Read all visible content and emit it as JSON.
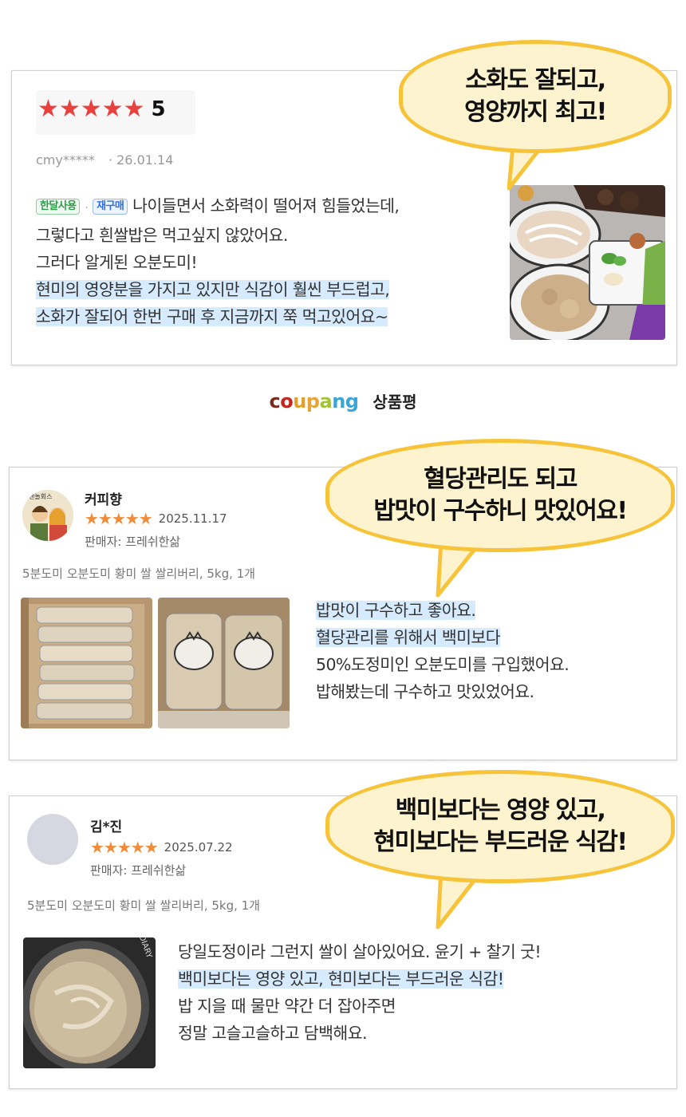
{
  "review1": {
    "rating_stars": "★★★★★",
    "rating_value": "5",
    "user": "cmy*****",
    "date": "· 26.01.14",
    "badge1": "한달사용",
    "badge_sep": "·",
    "badge2": "재구매",
    "line1": "나이들면서 소화력이 떨어져 힘들었는데,",
    "line2": "그렇다고 흰쌀밥은 먹고싶지 않았어요.",
    "line3": "그러다 알게된 오분도미!",
    "line4": "현미의 영양분을 가지고 있지만 식감이 훨씬 부드럽고,",
    "line5": "소화가 잘되어 한번 구매 후 지금까지 쭉 먹고있어요~",
    "bubble": [
      "소화도 잘되고,",
      "영양까지 최고!"
    ]
  },
  "brand": {
    "logo_c": "c",
    "logo_o": "o",
    "logo_u": "u",
    "logo_p": "p",
    "logo_a": "a",
    "logo_n": "n",
    "logo_g": "g",
    "label": "상품평"
  },
  "review2": {
    "user": "커피향",
    "avatar_text": "낸놀회스",
    "stars": "★★★★★",
    "date": "2025.11.17",
    "seller": "판매자: 프레쉬한삶",
    "product": "5분도미 오분도미 황미 쌀 쌀리버리, 5kg, 1개",
    "line1": "밥맛이 구수하고 좋아요.",
    "line2": "혈당관리를 위해서 백미보다",
    "line3": "50%도정미인 오분도미를 구입했어요.",
    "line4": "밥해봤는데 구수하고 맛있었어요.",
    "bubble": [
      "혈당관리도 되고",
      "밥맛이 구수하니 맛있어요!"
    ]
  },
  "review3": {
    "user": "김*진",
    "stars": "★★★★★",
    "date": "2025.07.22",
    "seller": "판매자: 프레쉬한삶",
    "product": "5분도미 오분도미 황미 쌀 쌀리버리, 5kg, 1개",
    "line1": "당일도정이라 그런지 쌀이 살아있어요. 윤기 + 찰기 굿!",
    "line2": "백미보다는 영양 있고, 현미보다는 부드러운 식감!",
    "line3": "밥 지을 때 물만 약간 더 잡아주면",
    "line4": "정말 고슬고슬하고 담백해요.",
    "bubble": [
      "백미보다는 영양 있고,",
      "현미보다는 부드러운 식감!"
    ],
    "cooker_text": "DIARY"
  },
  "colors": {
    "bubble_fill": "#fdf3cf",
    "bubble_border": "#f6c339",
    "highlight": "#d6ebff",
    "rating_star": "#e8413e",
    "orange_star": "#f08b3a"
  }
}
